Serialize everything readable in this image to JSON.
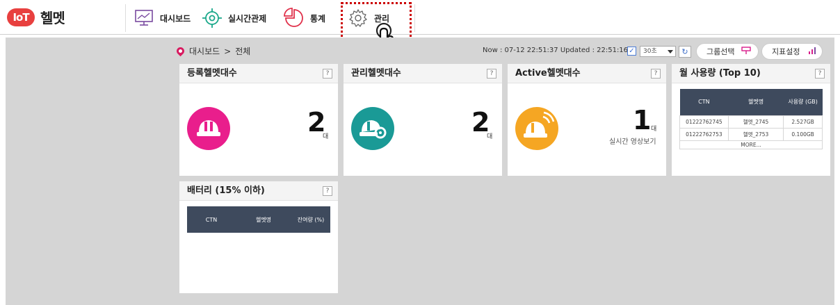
{
  "app": {
    "logo": "IoT",
    "name": "헬멧"
  },
  "nav": {
    "dashboard": "대시보드",
    "realtime": "실시간관제",
    "stats": "통계",
    "admin": "관리"
  },
  "breadcrumb": {
    "home": "대시보드",
    "current": "전체"
  },
  "status": {
    "text": "Now : 07-12 22:51:37  Updated : 22:51:16",
    "interval": "30초"
  },
  "buttons": {
    "group": "그룹선택",
    "metrics": "지표설정"
  },
  "cards": {
    "registered": {
      "title": "등록헬멧대수",
      "value": "2",
      "unit": "대"
    },
    "managed": {
      "title": "관리헬멧대수",
      "value": "2",
      "unit": "대"
    },
    "active": {
      "title": "Active헬멧대수",
      "value": "1",
      "unit": "대",
      "sub": "실시간 영상보기"
    },
    "usage": {
      "title": "월 사용량 (Top 10)",
      "columns": [
        "CTN",
        "헬멧명",
        "사용량 (GB)"
      ],
      "rows": [
        [
          "01222762745",
          "헬멧_2745",
          "2.527GB"
        ],
        [
          "01222762753",
          "헬멧_2753",
          "0.100GB"
        ]
      ],
      "more": "MORE..."
    },
    "battery": {
      "title": "배터리 (15% 이하)",
      "columns": [
        "CTN",
        "헬멧명",
        "잔여량 (%)"
      ]
    }
  },
  "help": "?",
  "colors": {
    "pink": "#e91e8c",
    "teal": "#1a9a96",
    "orange": "#f5a623",
    "brand": "#e8403f",
    "table_header": "#3e4a5d"
  }
}
